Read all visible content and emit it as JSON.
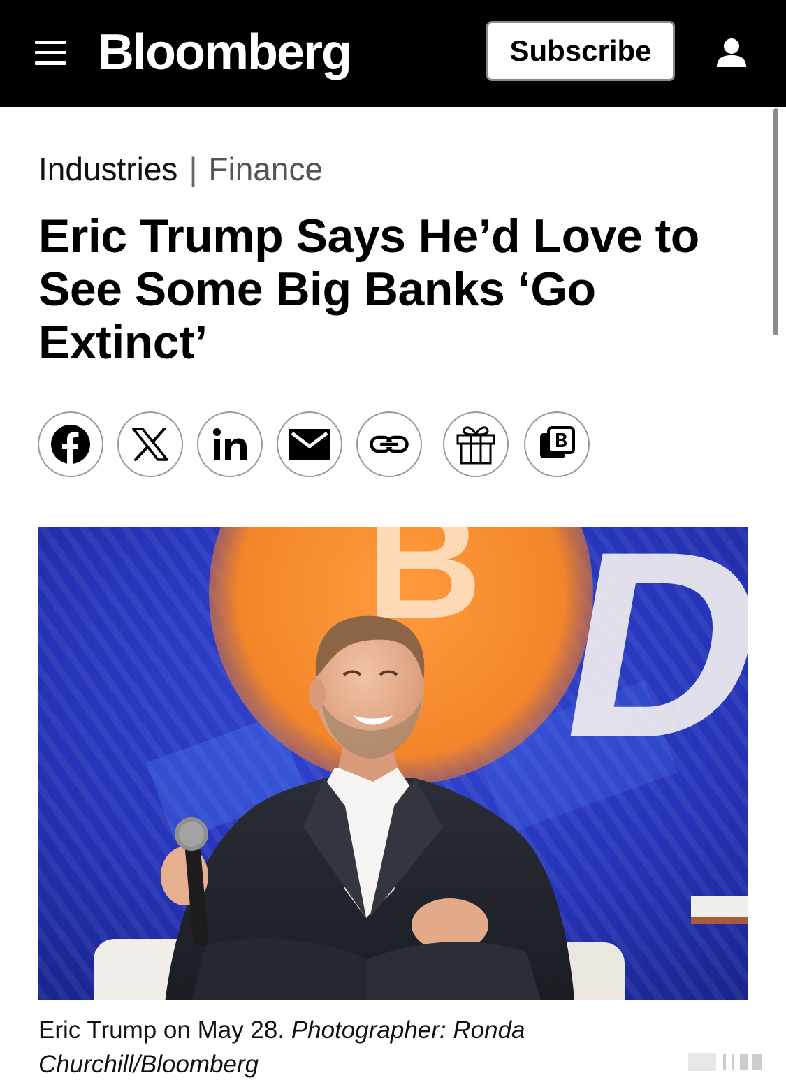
{
  "header": {
    "logo": "Bloomberg",
    "subscribe_label": "Subscribe"
  },
  "breadcrumb": {
    "section": "Industries",
    "separator": "|",
    "subsection": "Finance"
  },
  "article": {
    "headline": "Eric Trump Says He’d Love to See Some Big Banks ‘Go Extinct’",
    "image_overlay_letters": [
      "B",
      "D"
    ],
    "caption": "Eric Trump on May 28.",
    "credit": "Photographer: Ronda Churchill/Bloomberg"
  },
  "share_buttons": [
    {
      "icon": "facebook-icon"
    },
    {
      "icon": "x-icon"
    },
    {
      "icon": "linkedin-icon"
    },
    {
      "icon": "email-icon"
    },
    {
      "icon": "link-icon"
    },
    {
      "icon": "gift-icon"
    },
    {
      "icon": "bloomberg-app-icon"
    }
  ],
  "colors": {
    "header_bg": "#000000",
    "text": "#000000",
    "muted": "#555555",
    "bitcoin_orange": "#f28a2e",
    "stage_blue": "#2b3fd0"
  }
}
